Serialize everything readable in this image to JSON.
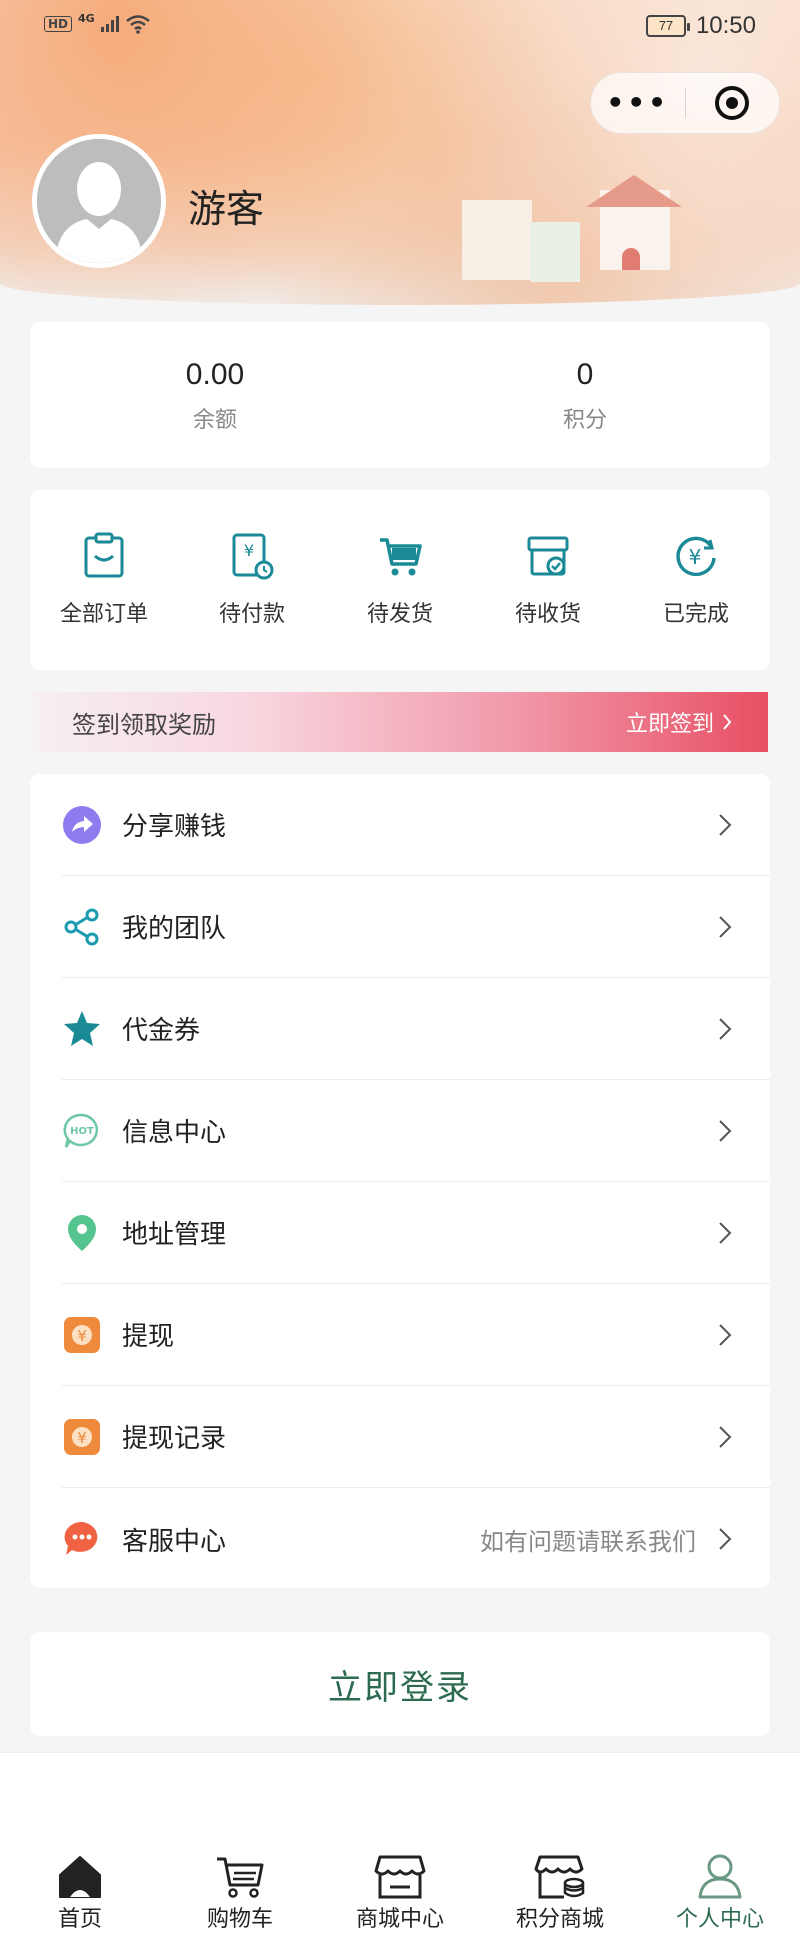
{
  "status_bar": {
    "hd": "HD",
    "network": "4G",
    "battery": "77",
    "time": "10:50"
  },
  "capsule": {
    "more_icon": "more-dots-icon",
    "close_icon": "target-icon"
  },
  "profile": {
    "name": "游客",
    "avatar_icon": "default-avatar-icon"
  },
  "stats": [
    {
      "value": "0.00",
      "label": "余额"
    },
    {
      "value": "0",
      "label": "积分"
    }
  ],
  "orders": [
    {
      "label": "全部订单",
      "icon": "clipboard-icon"
    },
    {
      "label": "待付款",
      "icon": "yuan-bill-icon"
    },
    {
      "label": "待发货",
      "icon": "cart-icon"
    },
    {
      "label": "待收货",
      "icon": "box-check-icon"
    },
    {
      "label": "已完成",
      "icon": "yuan-circle-icon"
    }
  ],
  "sign_banner": {
    "text": "签到领取奖励",
    "action": "立即签到"
  },
  "menu": [
    {
      "label": "分享赚钱",
      "note": "",
      "icon": "share-arrow-icon"
    },
    {
      "label": "我的团队",
      "note": "",
      "icon": "share-nodes-icon"
    },
    {
      "label": "代金券",
      "note": "",
      "icon": "star-icon"
    },
    {
      "label": "信息中心",
      "note": "",
      "icon": "hot-chat-icon"
    },
    {
      "label": "地址管理",
      "note": "",
      "icon": "location-pin-icon"
    },
    {
      "label": "提现",
      "note": "",
      "icon": "yuan-square-icon"
    },
    {
      "label": "提现记录",
      "note": "",
      "icon": "yuan-square-icon"
    },
    {
      "label": "客服中心",
      "note": "如有问题请联系我们",
      "icon": "chat-bubble-icon"
    }
  ],
  "login_button": "立即登录",
  "bottom_nav": [
    {
      "label": "首页",
      "icon": "home-icon",
      "active": false
    },
    {
      "label": "购物车",
      "icon": "cart-icon",
      "active": false
    },
    {
      "label": "商城中心",
      "icon": "store-icon",
      "active": false
    },
    {
      "label": "积分商城",
      "icon": "points-store-icon",
      "active": false
    },
    {
      "label": "个人中心",
      "icon": "person-icon",
      "active": true
    }
  ],
  "colors": {
    "accent": "#2c6b4f",
    "teal": "#1a8a96",
    "banner_end": "#e84f63",
    "purple": "#8c7cf0",
    "orange": "#ef8a3c",
    "chat_red": "#f06242",
    "pin_green": "#55c48f"
  }
}
